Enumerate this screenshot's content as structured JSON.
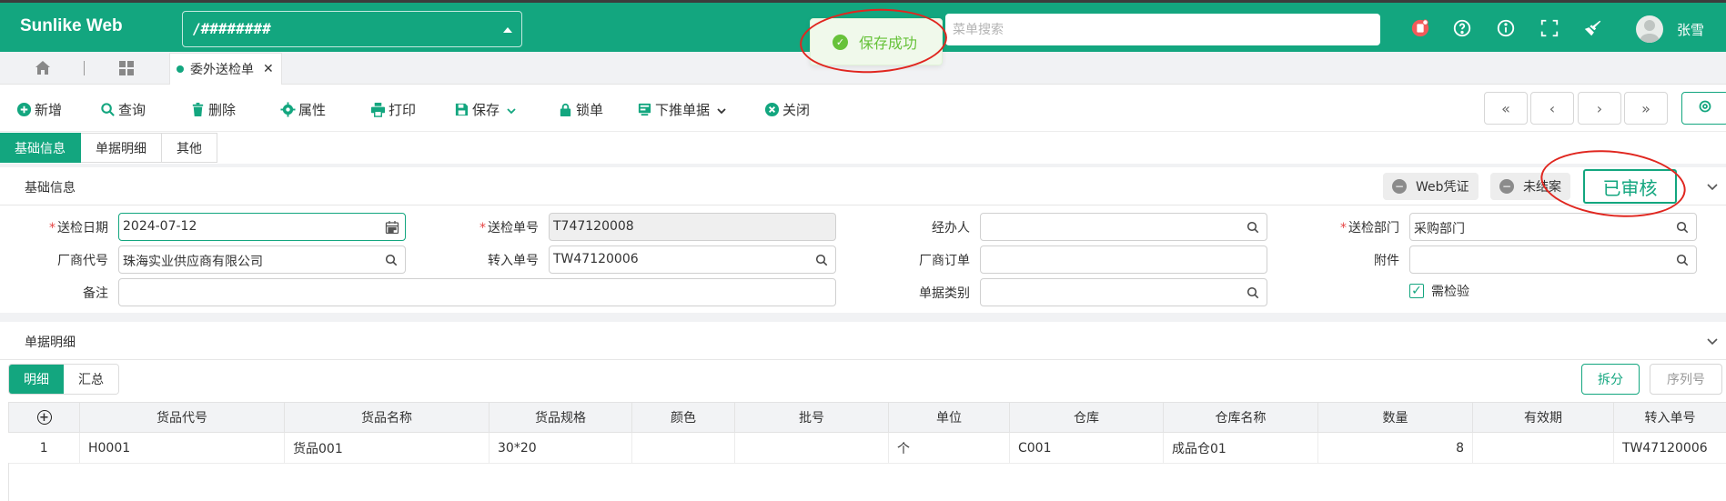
{
  "app": {
    "brand": "Sunlike Web",
    "path": "/########",
    "menu_search_placeholder": "菜单搜索",
    "user": "张雪"
  },
  "toast": {
    "message": "保存成功"
  },
  "tabs": {
    "open": [
      {
        "label": "委外送检单"
      }
    ]
  },
  "toolbar": {
    "add": "新增",
    "query": "查询",
    "delete": "删除",
    "props": "属性",
    "print": "打印",
    "save": "保存",
    "lock": "锁单",
    "push": "下推单据",
    "close": "关闭",
    "nav": {
      "first": "«",
      "prev": "‹",
      "next": "›",
      "last": "»"
    }
  },
  "section_tabs": [
    "基础信息",
    "单据明细",
    "其他"
  ],
  "basic": {
    "title": "基础信息",
    "web_voucher": "Web凭证",
    "not_closed": "未结案",
    "status": "已审核"
  },
  "form": {
    "inspect_date_label": "送检日期",
    "inspect_date": "2024-07-12",
    "inspect_no_label": "送检单号",
    "inspect_no": "T747120008",
    "handler_label": "经办人",
    "handler": "",
    "dept_label": "送检部门",
    "dept": "采购部门",
    "vendor_label": "厂商代号",
    "vendor": "珠海实业供应商有限公司",
    "transfer_no_label": "转入单号",
    "transfer_no": "TW47120006",
    "vendor_order_label": "厂商订单",
    "vendor_order": "",
    "attach_label": "附件",
    "attach": "",
    "remark_label": "备注",
    "remark": "",
    "doc_type_label": "单据类别",
    "doc_type": "",
    "need_inspect_label": "需检验"
  },
  "detail": {
    "title": "单据明细",
    "tabs": [
      "明细",
      "汇总"
    ],
    "split": "拆分",
    "serial": "序列号",
    "columns": [
      "货品代号",
      "货品名称",
      "货品规格",
      "颜色",
      "批号",
      "单位",
      "仓库",
      "仓库名称",
      "数量",
      "有效期",
      "转入单号"
    ],
    "rows": [
      {
        "idx": "1",
        "code": "H0001",
        "name": "货品001",
        "spec": "30*20",
        "color": "",
        "batch": "",
        "unit": "个",
        "wh": "C001",
        "wh_name": "成品仓01",
        "qty": "8",
        "expiry": "",
        "transfer": "TW47120006"
      }
    ]
  },
  "colors": {
    "brand": "#13a67f",
    "toast_text": "#67c23a",
    "annotation": "#e0261f"
  }
}
